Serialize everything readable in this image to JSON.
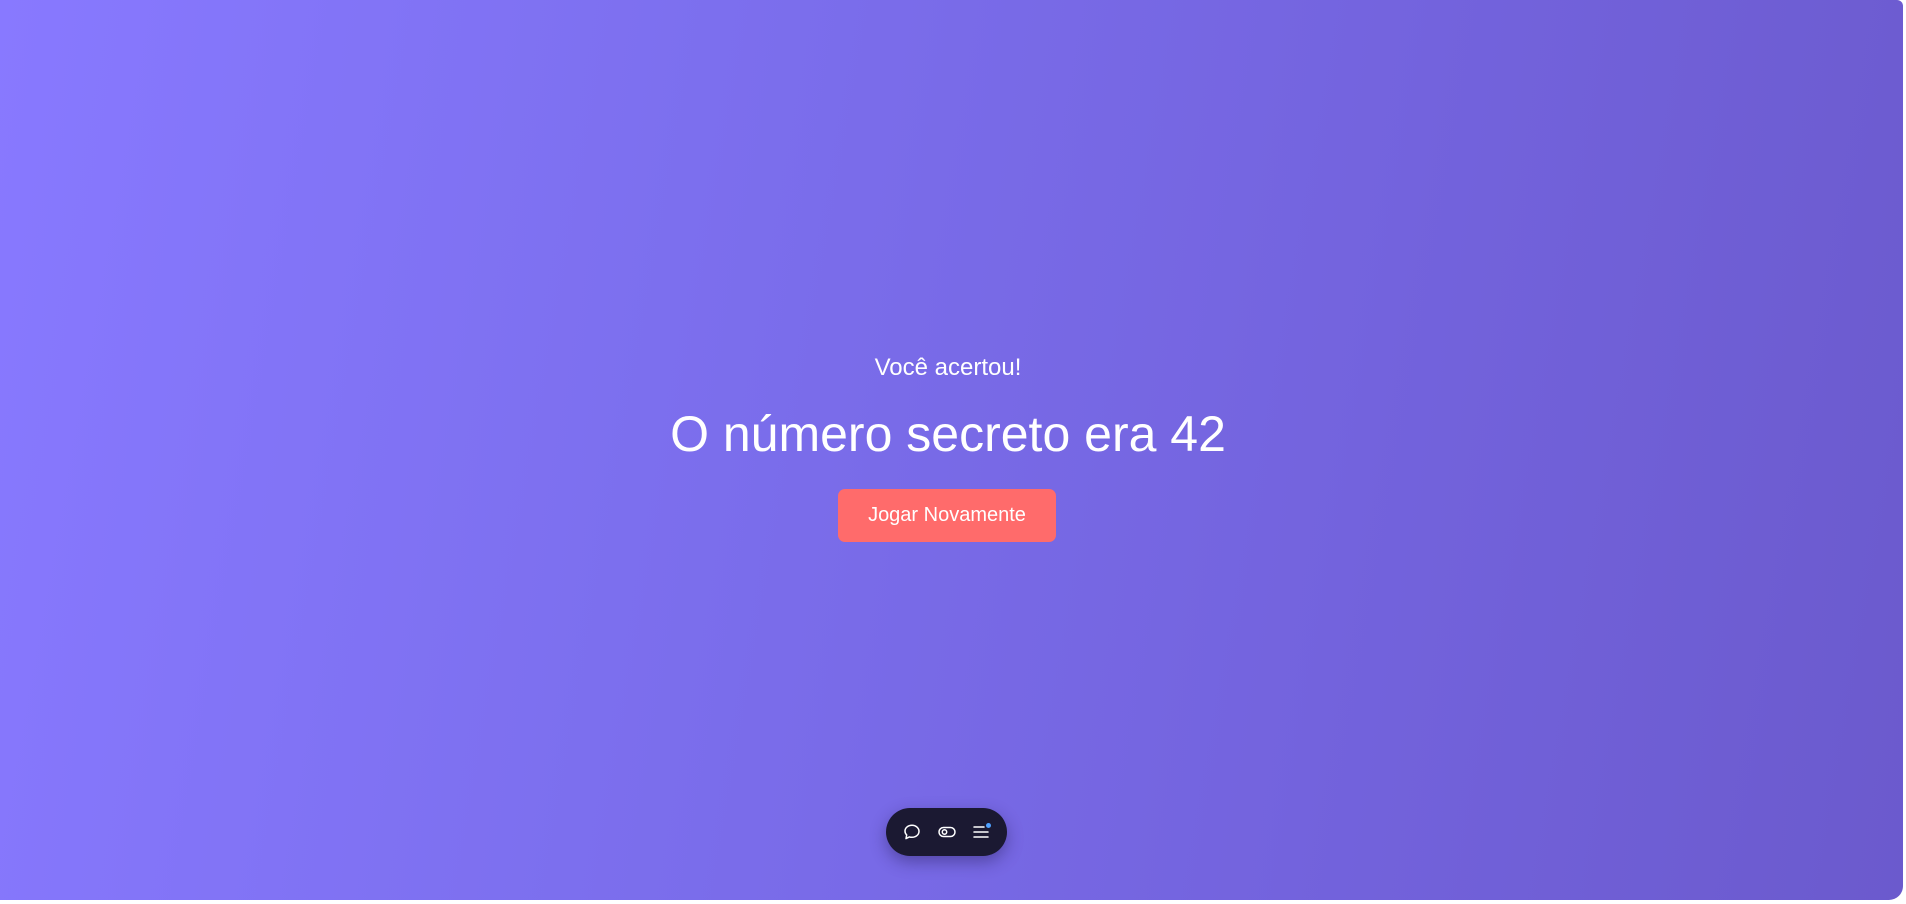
{
  "game": {
    "result_message": "Você acertou!",
    "secret_number_text": "O número secreto era 42",
    "play_again_label": "Jogar Novamente"
  },
  "toolbar": {
    "items": [
      {
        "icon": "chat-bubble-icon"
      },
      {
        "icon": "toggle-eye-icon"
      },
      {
        "icon": "menu-icon",
        "has_notification": true
      }
    ]
  },
  "colors": {
    "background_gradient_start": "#8879ff",
    "background_gradient_end": "#6b5acd",
    "button": "#ff6b6b",
    "toolbar": "#1b1932",
    "notification_dot": "#4ea1ff",
    "text": "#ffffff"
  }
}
